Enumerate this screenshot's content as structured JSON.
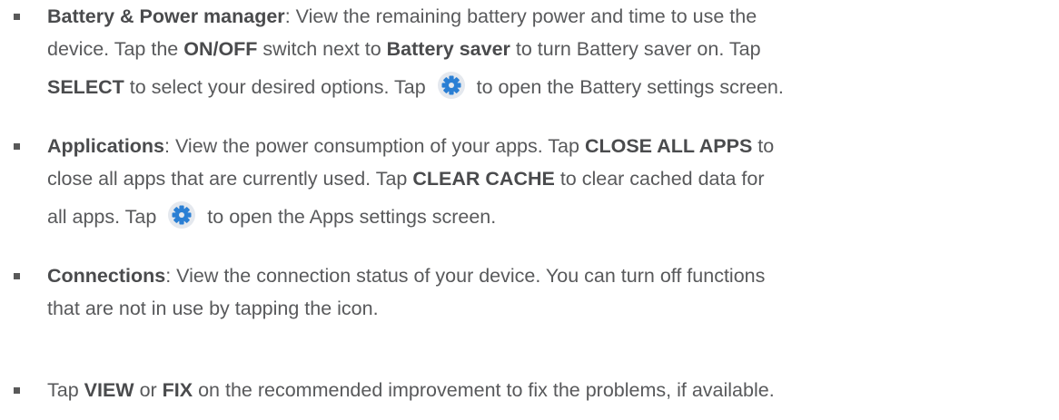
{
  "items": [
    {
      "title": "Battery & Power manager",
      "l1_rest": ": View the remaining battery power and time to use the",
      "l2_a": "device. Tap the ",
      "l2_b": "ON/OFF",
      "l2_c": " switch next to ",
      "l2_d": "Battery saver",
      "l2_e": " to turn Battery saver on. Tap",
      "l3_a": "SELECT",
      "l3_b": " to select your desired options. Tap ",
      "l3_c": " to open the Battery settings screen."
    },
    {
      "title": "Applications",
      "l1_rest": ": View the power consumption of your apps. Tap ",
      "l1_b": "CLOSE ALL APPS",
      "l1_c": " to",
      "l2_a": "close all apps that are currently used. Tap ",
      "l2_b": "CLEAR CACHE",
      "l2_c": " to clear cached data for",
      "l3_a": "all apps. Tap ",
      "l3_b": " to open the Apps settings screen."
    },
    {
      "title": "Connections",
      "l1_rest": ": View the connection status of your device. You can turn off functions",
      "l2_a": "that are not in use by tapping the icon."
    },
    {
      "l1_a": "Tap ",
      "l1_b": "VIEW",
      "l1_c": " or ",
      "l1_d": "FIX",
      "l1_e": " on the recommended improvement to fix the problems, if available."
    }
  ],
  "icons": {
    "gear": "gear-icon",
    "accent_color": "#2a7fd4"
  }
}
